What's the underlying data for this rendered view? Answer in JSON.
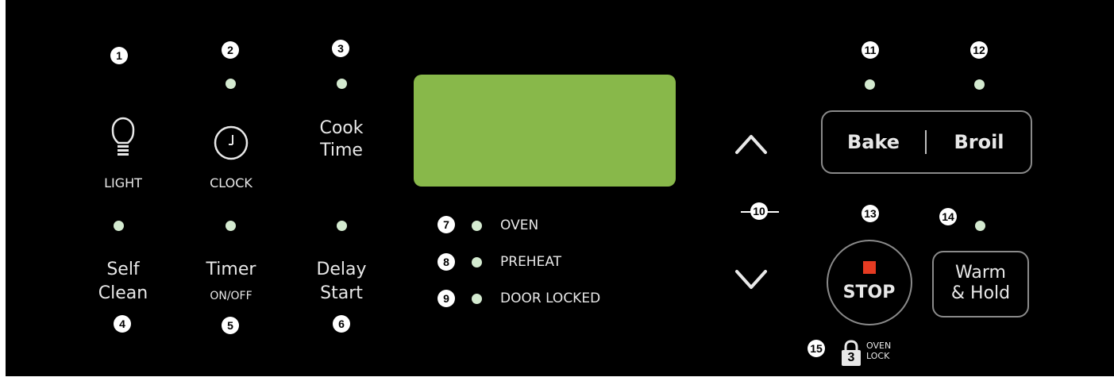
{
  "colors": {
    "background": "#000000",
    "display": "#88b84a",
    "indicator": "#d4ead0",
    "stop_square": "#e53b22",
    "outline": "#8a8a8a"
  },
  "callouts": [
    "1",
    "2",
    "3",
    "4",
    "5",
    "6",
    "7",
    "8",
    "9",
    "10",
    "11",
    "12",
    "13",
    "14",
    "15"
  ],
  "keys": {
    "light": {
      "label": "LIGHT",
      "icon": "lightbulb-icon"
    },
    "clock": {
      "label": "CLOCK",
      "icon": "clock-icon"
    },
    "cook_time": {
      "line1": "Cook",
      "line2": "Time"
    },
    "self_clean": {
      "line1": "Self",
      "line2": "Clean"
    },
    "timer": {
      "line1": "Timer",
      "line2": "ON/OFF"
    },
    "delay_start": {
      "line1": "Delay",
      "line2": "Start"
    },
    "bake": "Bake",
    "broil": "Broil",
    "stop": "STOP",
    "warm_hold": {
      "line1": "Warm",
      "line2": "& Hold"
    },
    "oven_lock": {
      "digit": "3",
      "line1": "OVEN",
      "line2": "LOCK"
    }
  },
  "status": {
    "oven": "OVEN",
    "preheat": "PREHEAT",
    "door_locked": "DOOR LOCKED"
  },
  "arrows": {
    "up": "up-arrow-icon",
    "down": "down-arrow-icon"
  }
}
